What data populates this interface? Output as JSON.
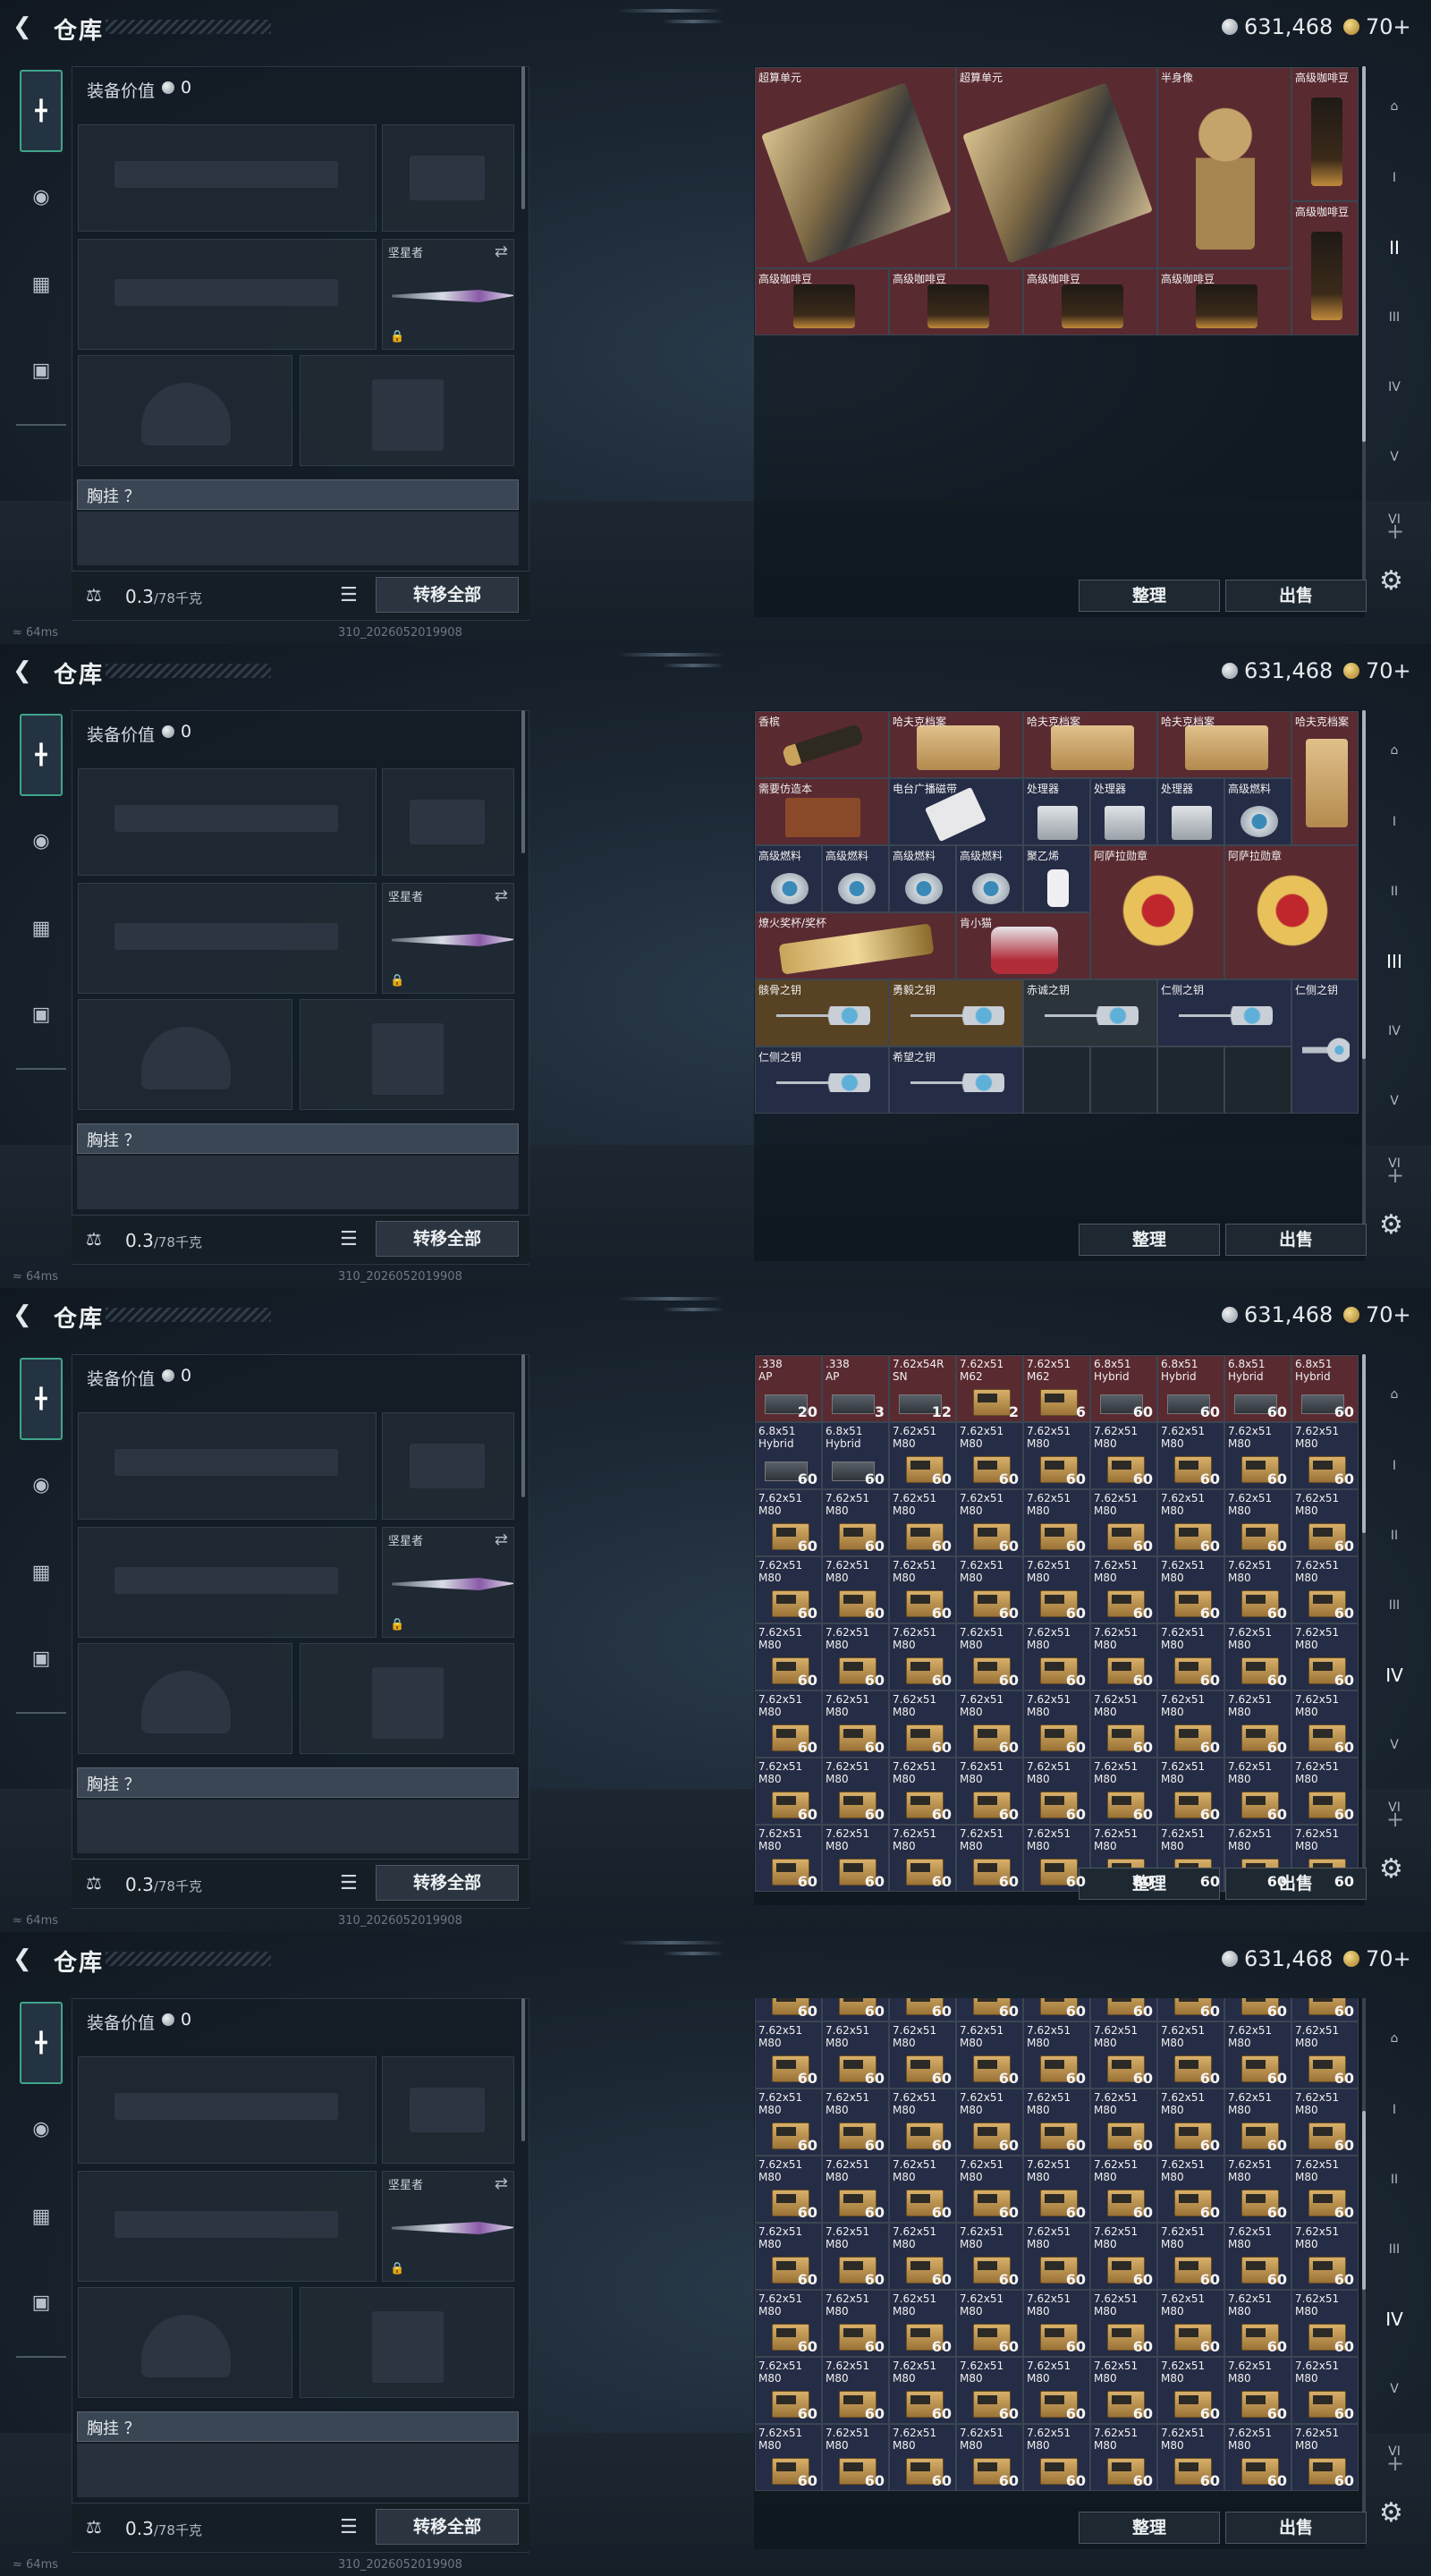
{
  "app": {
    "title": "仓库",
    "silver": "631,468",
    "gold": "70+"
  },
  "equip": {
    "value_label": "装备价值",
    "value": "0",
    "melee_name": "坚星者",
    "chest_label": "胸挂 ？",
    "weight_current": "0.3",
    "weight_max": "/78千克",
    "transfer_label": "转移全部"
  },
  "stash": {
    "sort_label": "整理",
    "sell_label": "出售"
  },
  "status": {
    "ping": "64ms",
    "build": "310_2026052019908"
  },
  "screens": [
    {
      "items": [
        {
          "name": "超算单元",
          "tone": "red",
          "col": 0,
          "row": 0,
          "w": 3,
          "h": 3,
          "icon": "supercomputer-unit"
        },
        {
          "name": "超算单元",
          "tone": "red",
          "col": 3,
          "row": 0,
          "w": 3,
          "h": 3,
          "icon": "supercomputer-unit"
        },
        {
          "name": "半身像",
          "tone": "red",
          "col": 6,
          "row": 0,
          "w": 2,
          "h": 3,
          "icon": "bust"
        },
        {
          "name": "高级咖啡豆",
          "tone": "red",
          "col": 8,
          "row": 0,
          "w": 1,
          "h": 2,
          "icon": "coffee-beans"
        },
        {
          "name": "高级咖啡豆",
          "tone": "red",
          "col": 8,
          "row": 2,
          "w": 1,
          "h": 2,
          "icon": "coffee-beans"
        },
        {
          "name": "高级咖啡豆",
          "tone": "red",
          "col": 0,
          "row": 3,
          "w": 2,
          "h": 1,
          "icon": "coffee-beans"
        },
        {
          "name": "高级咖啡豆",
          "tone": "red",
          "col": 2,
          "row": 3,
          "w": 2,
          "h": 1,
          "icon": "coffee-beans"
        },
        {
          "name": "高级咖啡豆",
          "tone": "red",
          "col": 4,
          "row": 3,
          "w": 2,
          "h": 1,
          "icon": "coffee-beans"
        },
        {
          "name": "高级咖啡豆",
          "tone": "red",
          "col": 6,
          "row": 3,
          "w": 2,
          "h": 1,
          "icon": "coffee-beans"
        }
      ]
    },
    {
      "items": [
        {
          "name": "香槟",
          "tone": "red",
          "col": 0,
          "row": 0,
          "w": 2,
          "h": 1,
          "icon": "champagne"
        },
        {
          "name": "哈夫克档案",
          "tone": "red",
          "col": 2,
          "row": 0,
          "w": 2,
          "h": 1,
          "icon": "dossier"
        },
        {
          "name": "哈夫克档案",
          "tone": "red",
          "col": 4,
          "row": 0,
          "w": 2,
          "h": 1,
          "icon": "dossier"
        },
        {
          "name": "哈夫克档案",
          "tone": "red",
          "col": 6,
          "row": 0,
          "w": 2,
          "h": 1,
          "icon": "dossier"
        },
        {
          "name": "哈夫克档案",
          "tone": "red",
          "col": 8,
          "row": 0,
          "w": 1,
          "h": 2,
          "icon": "dossier"
        },
        {
          "name": "需要仿造本",
          "tone": "red",
          "col": 0,
          "row": 1,
          "w": 2,
          "h": 1,
          "icon": "book"
        },
        {
          "name": "电台广播磁带",
          "tone": "navy",
          "col": 2,
          "row": 1,
          "w": 2,
          "h": 1,
          "icon": "tape"
        },
        {
          "name": "处理器",
          "tone": "navy",
          "col": 4,
          "row": 1,
          "w": 1,
          "h": 1,
          "icon": "processor"
        },
        {
          "name": "处理器",
          "tone": "navy",
          "col": 5,
          "row": 1,
          "w": 1,
          "h": 1,
          "icon": "processor"
        },
        {
          "name": "处理器",
          "tone": "navy",
          "col": 6,
          "row": 1,
          "w": 1,
          "h": 1,
          "icon": "processor"
        },
        {
          "name": "高级燃料",
          "tone": "navy",
          "col": 7,
          "row": 1,
          "w": 1,
          "h": 1,
          "icon": "fuel"
        },
        {
          "name": "高级燃料",
          "tone": "navy",
          "col": 0,
          "row": 2,
          "w": 1,
          "h": 1,
          "icon": "fuel"
        },
        {
          "name": "高级燃料",
          "tone": "navy",
          "col": 1,
          "row": 2,
          "w": 1,
          "h": 1,
          "icon": "fuel"
        },
        {
          "name": "高级燃料",
          "tone": "navy",
          "col": 2,
          "row": 2,
          "w": 1,
          "h": 1,
          "icon": "fuel"
        },
        {
          "name": "高级燃料",
          "tone": "navy",
          "col": 3,
          "row": 2,
          "w": 1,
          "h": 1,
          "icon": "fuel"
        },
        {
          "name": "聚乙烯",
          "tone": "navy",
          "col": 4,
          "row": 2,
          "w": 1,
          "h": 1,
          "icon": "polyethylene"
        },
        {
          "name": "阿萨拉勋章",
          "tone": "red",
          "col": 5,
          "row": 2,
          "w": 2,
          "h": 2,
          "icon": "medal"
        },
        {
          "name": "阿萨拉勋章",
          "tone": "red",
          "col": 7,
          "row": 2,
          "w": 2,
          "h": 2,
          "icon": "medal"
        },
        {
          "name": "燎火奖杯/奖杯",
          "tone": "red",
          "col": 0,
          "row": 3,
          "w": 3,
          "h": 1,
          "icon": "trophy"
        },
        {
          "name": "肯小猫",
          "tone": "red",
          "col": 3,
          "row": 3,
          "w": 2,
          "h": 1,
          "icon": "robot"
        },
        {
          "name": "骸骨之钥",
          "tone": "amber",
          "col": 0,
          "row": 4,
          "w": 2,
          "h": 1,
          "icon": "key"
        },
        {
          "name": "勇毅之钥",
          "tone": "amber",
          "col": 2,
          "row": 4,
          "w": 2,
          "h": 1,
          "icon": "key"
        },
        {
          "name": "赤诚之钥",
          "tone": "gray",
          "col": 4,
          "row": 4,
          "w": 2,
          "h": 1,
          "icon": "key"
        },
        {
          "name": "仁侧之钥",
          "tone": "navy",
          "col": 6,
          "row": 4,
          "w": 2,
          "h": 1,
          "icon": "key"
        },
        {
          "name": "仁侧之钥",
          "tone": "navy",
          "col": 8,
          "row": 4,
          "w": 1,
          "h": 2,
          "icon": "key"
        },
        {
          "name": "仁侧之钥",
          "tone": "navy",
          "col": 0,
          "row": 5,
          "w": 2,
          "h": 1,
          "icon": "key"
        },
        {
          "name": "希望之钥",
          "tone": "navy",
          "col": 2,
          "row": 5,
          "w": 2,
          "h": 1,
          "icon": "key"
        }
      ]
    },
    {
      "ammo_header": [
        {
          "l1": ".338",
          "l2": "AP",
          "count": "20",
          "kind": "box"
        },
        {
          "l1": ".338",
          "l2": "AP",
          "count": "3",
          "kind": "box"
        },
        {
          "l1": "7.62x54R",
          "l2": "SN",
          "count": "12",
          "kind": "box"
        },
        {
          "l1": "7.62x51",
          "l2": "M62",
          "count": "2",
          "kind": "crate"
        },
        {
          "l1": "7.62x51",
          "l2": "M62",
          "count": "6",
          "kind": "crate"
        },
        {
          "l1": "6.8x51",
          "l2": "Hybrid",
          "count": "60",
          "kind": "box"
        },
        {
          "l1": "6.8x51",
          "l2": "Hybrid",
          "count": "60",
          "kind": "box"
        },
        {
          "l1": "6.8x51",
          "l2": "Hybrid",
          "count": "60",
          "kind": "box"
        },
        {
          "l1": "6.8x51",
          "l2": "Hybrid",
          "count": "60",
          "kind": "box"
        }
      ],
      "ammo_row2": [
        {
          "l1": "6.8x51",
          "l2": "Hybrid",
          "count": "60",
          "kind": "box"
        },
        {
          "l1": "6.8x51",
          "l2": "Hybrid",
          "count": "60",
          "kind": "box"
        }
      ],
      "ammo_fill": {
        "l1": "7.62x51",
        "l2": "M80",
        "count": "60"
      }
    },
    {
      "ammo_fill": {
        "l1": "7.62x51",
        "l2": "M80",
        "count": "60"
      }
    }
  ]
}
